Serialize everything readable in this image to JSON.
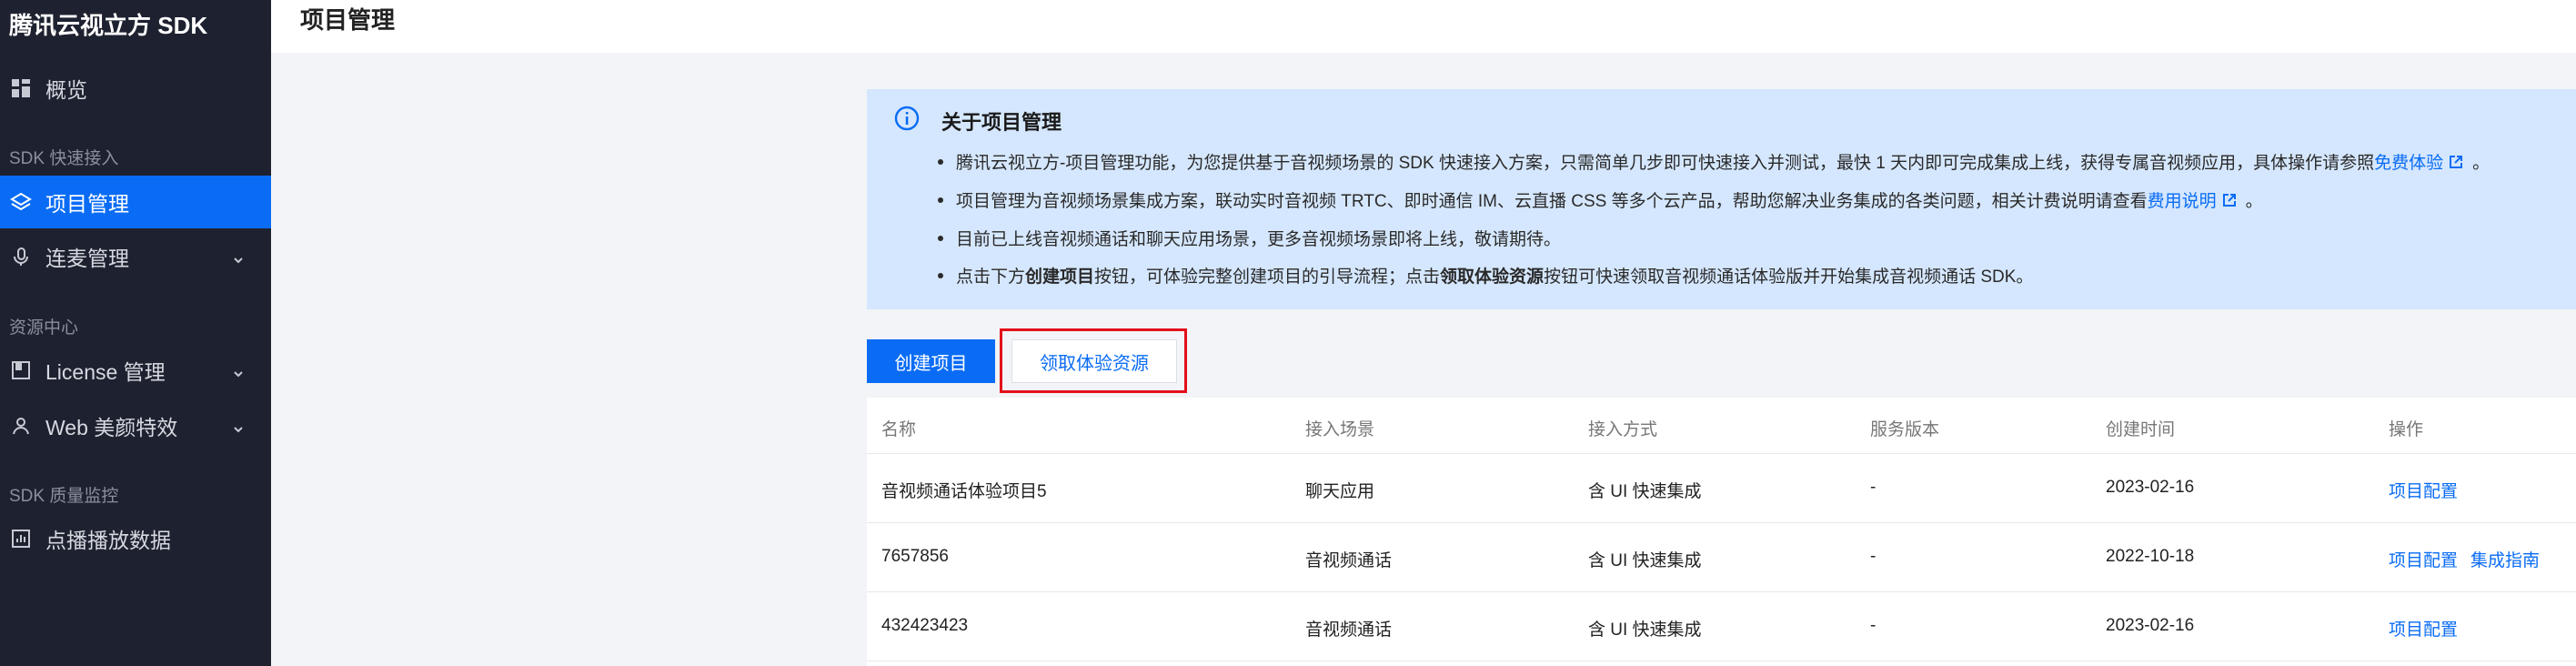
{
  "app": {
    "brand": "腾讯云视立方 SDK"
  },
  "colors": {
    "sidebar_bg": "#1e2230",
    "accent": "#0a6cf5",
    "highlight_border": "#e3101a",
    "info_bg": "#d5e7fe"
  },
  "sidebar": {
    "items": [
      {
        "label": "概览",
        "icon": "dashboard-icon"
      },
      {
        "label": "项目管理",
        "icon": "layers-icon",
        "active": true
      },
      {
        "label": "连麦管理",
        "icon": "mic-icon"
      },
      {
        "label": "License 管理",
        "icon": "license-icon"
      },
      {
        "label": "Web 美颜特效",
        "icon": "user-icon"
      },
      {
        "label": "点播播放数据",
        "icon": "chart-icon"
      }
    ],
    "groups": [
      "SDK 快速接入",
      "资源中心",
      "SDK 质量监控"
    ]
  },
  "header": {
    "title": "项目管理"
  },
  "info": {
    "title": "关于项目管理",
    "line1": {
      "text": "腾讯云视立方-项目管理功能，为您提供基于音视频场景的 SDK 快速接入方案，只需简单几步即可快速接入并测试，最快 1 天内即可完成集成上线，获得专属音视频应用，具体操作请参照 ",
      "link": "免费体验",
      "suffix": "。"
    },
    "line2": {
      "text": "项目管理为音视频场景集成方案，联动实时音视频 TRTC、即时通信 IM、云直播 CSS 等多个云产品，帮助您解决业务集成的各类问题，相关计费说明请查看 ",
      "link": "费用说明",
      "suffix": "。"
    },
    "line3": {
      "text": "目前已上线音视频通话和聊天应用场景，更多音视频场景即将上线，敬请期待。"
    },
    "line4": {
      "p1": "点击下方 ",
      "b1": "创建项目",
      "p2": " 按钮，可体验完整创建项目的引导流程；点击 ",
      "b2": "领取体验资源",
      "p3": " 按钮可快速领取音视频通话体验版并开始集成音视频通话 SDK。"
    }
  },
  "actions": {
    "create": "创建项目",
    "claim": "领取体验资源"
  },
  "table": {
    "headers": [
      "名称",
      "接入场景",
      "接入方式",
      "服务版本",
      "创建时间",
      "操作"
    ],
    "rows": [
      {
        "name": "音视频通话体验项目5",
        "scene": "聊天应用",
        "method": "含 UI 快速集成",
        "version": "-",
        "created": "2023-02-16",
        "op1": "项目配置",
        "op2": ""
      },
      {
        "name": "7657856",
        "scene": "音视频通话",
        "method": "含 UI 快速集成",
        "version": "-",
        "created": "2022-10-18",
        "op1": "项目配置",
        "op2": "集成指南"
      },
      {
        "name": "432423423",
        "scene": "音视频通话",
        "method": "含 UI 快速集成",
        "version": "-",
        "created": "2023-02-16",
        "op1": "项目配置",
        "op2": ""
      }
    ]
  }
}
